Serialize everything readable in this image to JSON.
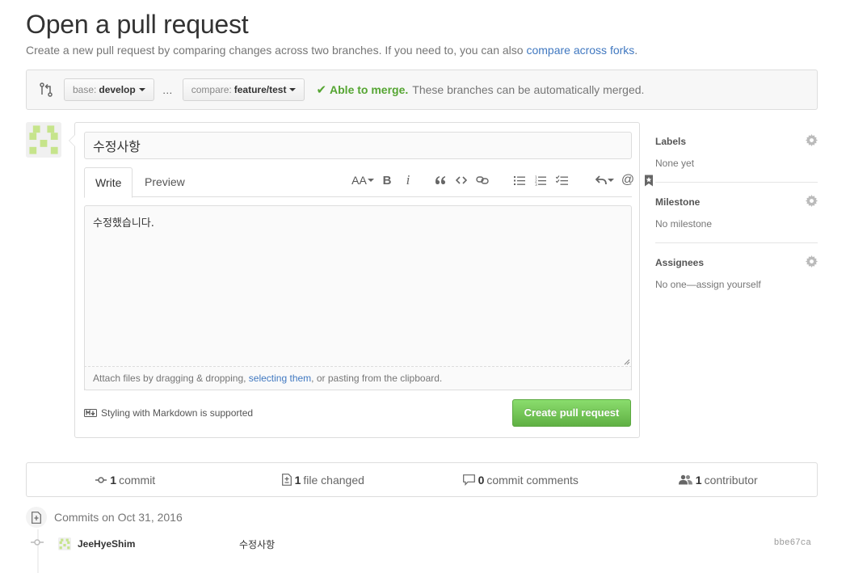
{
  "header": {
    "title": "Open a pull request",
    "subtitle_prefix": "Create a new pull request by comparing changes across two branches. If you need to, you can also ",
    "subtitle_link": "compare across forks",
    "subtitle_suffix": "."
  },
  "range": {
    "base_prefix": "base:",
    "base_value": "develop",
    "ellipsis": "…",
    "compare_prefix": "compare:",
    "compare_value": "feature/test",
    "merge_status": "Able to merge.",
    "merge_message": "These branches can be automatically merged."
  },
  "composer": {
    "title_value": "수정사항",
    "tabs": [
      {
        "label": "Write",
        "active": true
      },
      {
        "label": "Preview",
        "active": false
      }
    ],
    "toolbar_icons": [
      "text-size-icon",
      "bold-icon",
      "italic-icon",
      "quote-icon",
      "code-icon",
      "link-icon",
      "unordered-list-icon",
      "ordered-list-icon",
      "task-list-icon",
      "reply-icon",
      "mention-icon",
      "bookmark-icon"
    ],
    "toolbar_text": {
      "text_size": "AA",
      "bold": "B",
      "italic": "i",
      "mention": "@"
    },
    "body_value": "수정했습니다.",
    "attach_prefix": "Attach files by dragging & dropping, ",
    "attach_link": "selecting them",
    "attach_suffix": ", or pasting from the clipboard.",
    "markdown_note": "Styling with Markdown is supported",
    "submit_label": "Create pull request"
  },
  "sidebar": {
    "sections": [
      {
        "heading": "Labels",
        "value": "None yet"
      },
      {
        "heading": "Milestone",
        "value": "No milestone"
      },
      {
        "heading": "Assignees",
        "value": "No one—assign yourself"
      }
    ]
  },
  "summary": {
    "commits_count": "1",
    "commits_label": "commit",
    "files_count": "1",
    "files_label": "file changed",
    "comments_count": "0",
    "comments_label": "commit comments",
    "contributors_count": "1",
    "contributors_label": "contributor"
  },
  "commits": {
    "heading": "Commits on Oct 31, 2016",
    "items": [
      {
        "author": "JeeHyeShim",
        "message": "수정사항",
        "sha": "bbe67ca"
      }
    ]
  },
  "colors": {
    "accent_link": "#4078c0",
    "success": "#55a532",
    "button_green": "#60b044",
    "avatar_green": "#c6e48b"
  }
}
